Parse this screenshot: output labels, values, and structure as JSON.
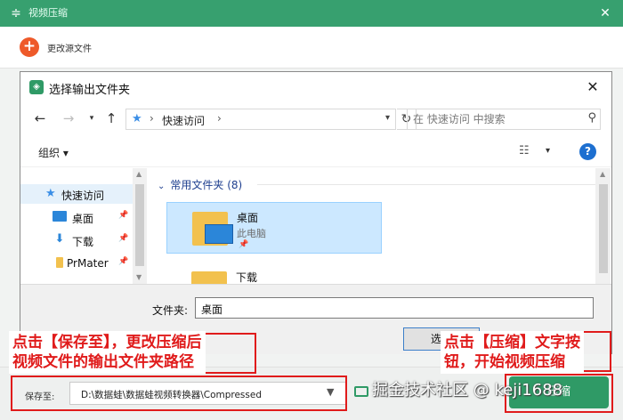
{
  "app": {
    "title": "视频压缩",
    "source_action": "更改源文件"
  },
  "dialog": {
    "title": "选择输出文件夹",
    "breadcrumb": "快速访问",
    "search_placeholder": "在 快速访问 中搜索",
    "organize_label": "组织 ▾",
    "nav": {
      "quick_access": "快速访问",
      "items": [
        {
          "label": "桌面",
          "icon": "desktop-icon"
        },
        {
          "label": "下载",
          "icon": "download-icon"
        },
        {
          "label": "PrMater",
          "icon": "folder-icon"
        }
      ]
    },
    "group_header": "常用文件夹 (8)",
    "tiles": [
      {
        "name": "桌面",
        "sub": "此电脑"
      },
      {
        "name": "下载"
      }
    ],
    "folder_label": "文件夹:",
    "folder_value": "桌面",
    "select_button": "选择"
  },
  "savebar": {
    "label": "保存至:",
    "path": "D:\\数据蛙\\数据蛙视频转换器\\Compressed",
    "compress_button": "压缩"
  },
  "annotations": {
    "left_line1": "点击【保存至】，更改压缩后",
    "left_line2": "视频文件的输出文件夹路径",
    "right_line1": "点击【压缩】文字按",
    "right_line2": "钮，开始视频压缩"
  },
  "watermark": "掘金技术社区 @ keji1688",
  "colors": {
    "brand_green": "#37a06f",
    "accent_orange": "#ee5a2a",
    "annotation_red": "#e01b1b",
    "selection_blue": "#cce8ff"
  }
}
